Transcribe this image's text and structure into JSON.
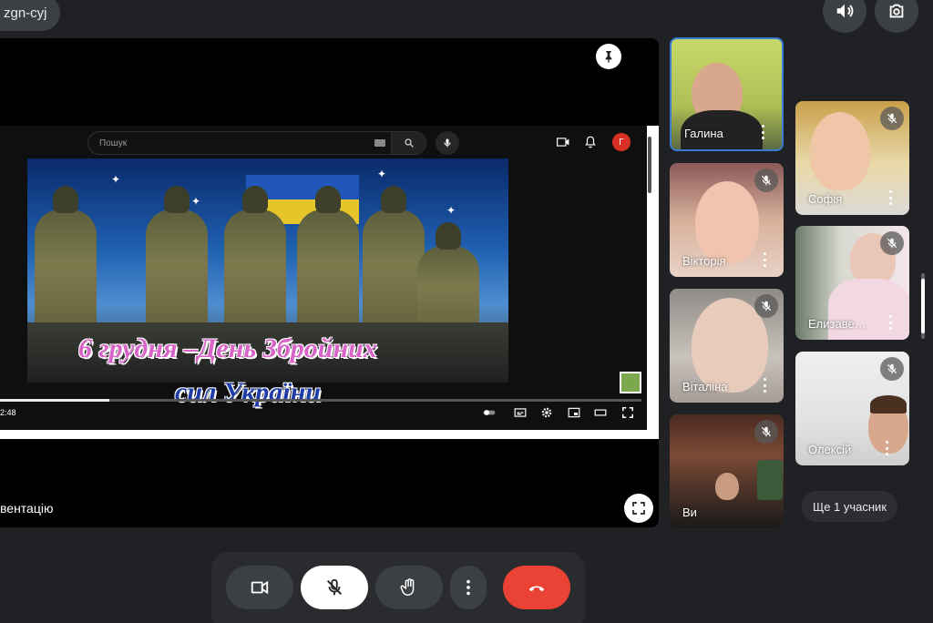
{
  "meeting": {
    "code": "zgn-cyj"
  },
  "presentation": {
    "label": "вентацію",
    "youtube": {
      "search_placeholder": "Пошук",
      "avatar_letter": "Г",
      "time": "2:48"
    },
    "video_caption_line1": "6 грудня –День Збройних",
    "video_caption_line2": "сил України",
    "progress_fraction": 0.17
  },
  "participants": [
    {
      "name": "Галина",
      "muted": false,
      "active": true
    },
    {
      "name": "Вікторія",
      "muted": true
    },
    {
      "name": "Віталіна",
      "muted": true
    },
    {
      "name": "Ви",
      "muted": true
    },
    {
      "name": "Софія",
      "muted": true
    },
    {
      "name": "Елизаве…",
      "muted": true
    },
    {
      "name": "Олексій",
      "muted": true
    }
  ],
  "more_participants_label": "Ще 1 учасник",
  "colors": {
    "background": "#202124",
    "end_call": "#ea4335",
    "active_border": "#3a7bd5"
  },
  "icons": [
    "volume-icon",
    "switch-camera-icon",
    "pin-icon",
    "camera-icon",
    "mic-off-icon",
    "raise-hand-icon",
    "more-vert-icon",
    "end-call-icon",
    "fullscreen-icon"
  ]
}
